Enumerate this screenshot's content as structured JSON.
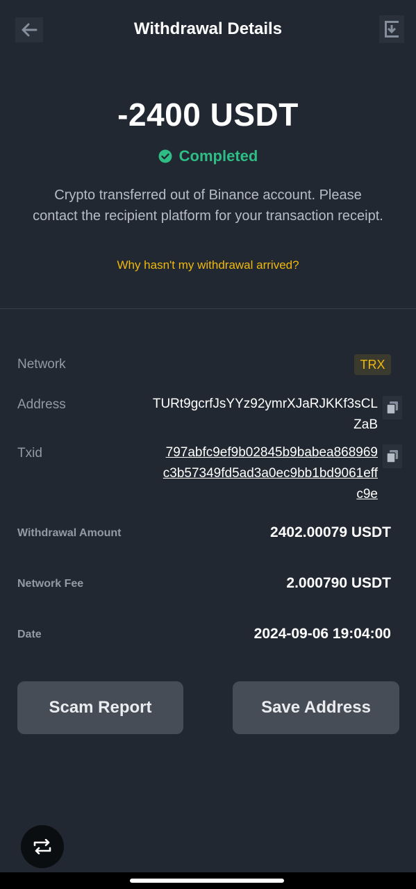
{
  "header": {
    "title": "Withdrawal Details",
    "back_icon": "arrow-left-icon",
    "share_icon": "download-receipt-icon"
  },
  "summary": {
    "amount": "-2400 USDT",
    "status": "Completed",
    "status_icon": "check-circle-icon",
    "description": "Crypto transferred out of Binance account. Please contact the recipient platform for your transaction receipt.",
    "help_link": "Why hasn't my withdrawal arrived?"
  },
  "details": {
    "network_label": "Network",
    "network_value": "TRX",
    "address_label": "Address",
    "address_value": "TURt9gcrfJsYYz92ymrXJaRJKKf3sCLZaB",
    "txid_label": "Txid",
    "txid_value": "797abfc9ef9b02845b9babea868969c3b57349fd5ad3a0ec9bb1bd9061effc9e",
    "amount_label": "Withdrawal Amount",
    "amount_value": "2402.00079 USDT",
    "fee_label": "Network Fee",
    "fee_value": "2.000790 USDT",
    "date_label": "Date",
    "date_value": "2024-09-06 19:04:00"
  },
  "actions": {
    "scam_report": "Scam Report",
    "save_address": "Save Address"
  },
  "colors": {
    "background": "#222832",
    "success": "#2ebd85",
    "accent": "#f0b90b",
    "button": "#474d57"
  }
}
